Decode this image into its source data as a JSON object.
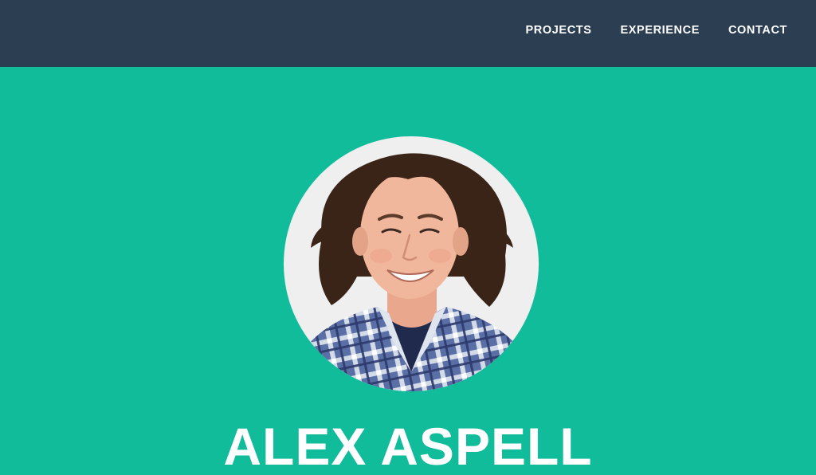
{
  "nav": {
    "items": [
      {
        "label": "PROJECTS"
      },
      {
        "label": "EXPERIENCE"
      },
      {
        "label": "CONTACT"
      }
    ]
  },
  "hero": {
    "name": "ALEX ASPELL"
  },
  "colors": {
    "navbar_bg": "#2c3e51",
    "hero_bg": "#11bc9b",
    "text": "#ffffff"
  }
}
